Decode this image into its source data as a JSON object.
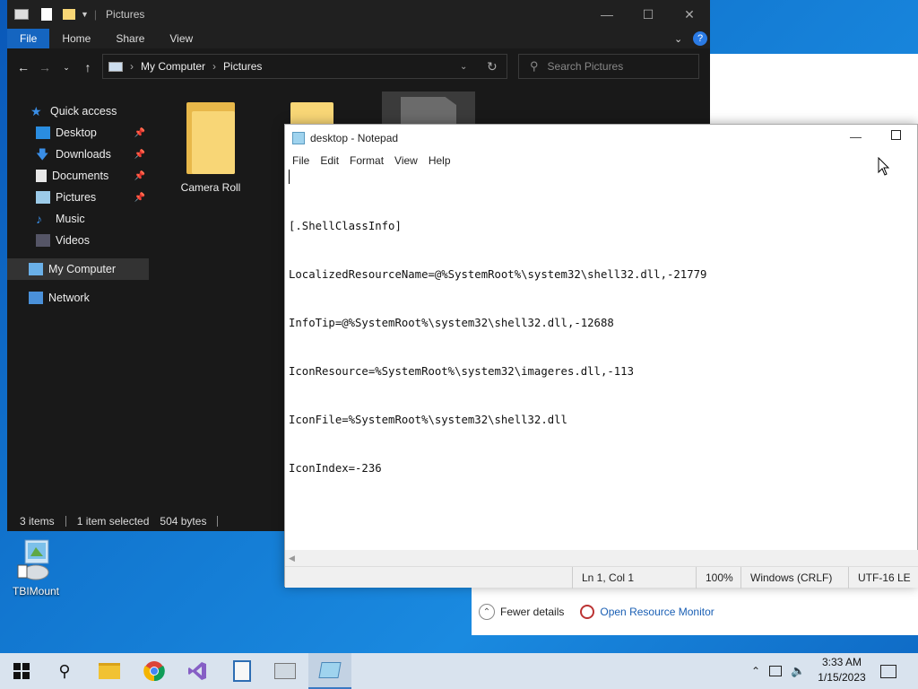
{
  "explorer": {
    "title": "Pictures",
    "ribbon_tabs": [
      "File",
      "Home",
      "Share",
      "View"
    ],
    "breadcrumb": [
      "My Computer",
      "Pictures"
    ],
    "search_placeholder": "Search Pictures",
    "sidebar": [
      {
        "label": "Quick access",
        "icon": "star-icon",
        "pinned": false
      },
      {
        "label": "Desktop",
        "icon": "desktop-icon",
        "pinned": true
      },
      {
        "label": "Downloads",
        "icon": "download-icon",
        "pinned": true
      },
      {
        "label": "Documents",
        "icon": "document-icon",
        "pinned": true
      },
      {
        "label": "Pictures",
        "icon": "pictures-icon",
        "pinned": true
      },
      {
        "label": "Music",
        "icon": "music-icon",
        "pinned": false
      },
      {
        "label": "Videos",
        "icon": "video-icon",
        "pinned": false
      },
      {
        "label": "My Computer",
        "icon": "computer-icon",
        "pinned": false
      },
      {
        "label": "Network",
        "icon": "network-icon",
        "pinned": false
      }
    ],
    "items": [
      {
        "label": "Camera Roll"
      }
    ],
    "status": {
      "count": "3 items",
      "selection": "1 item selected",
      "size": "504 bytes"
    }
  },
  "notepad": {
    "title": "desktop - Notepad",
    "menu": [
      "File",
      "Edit",
      "Format",
      "View",
      "Help"
    ],
    "lines": [
      "[.ShellClassInfo]",
      "LocalizedResourceName=@%SystemRoot%\\system32\\shell32.dll,-21779",
      "InfoTip=@%SystemRoot%\\system32\\shell32.dll,-12688",
      "IconResource=%SystemRoot%\\system32\\imageres.dll,-113",
      "IconFile=%SystemRoot%\\system32\\shell32.dll",
      "IconIndex=-236"
    ],
    "status": {
      "position": "Ln 1, Col 1",
      "zoom": "100%",
      "line_ending": "Windows (CRLF)",
      "encoding": "UTF-16 LE"
    }
  },
  "taskmgr": {
    "fewer_details": "Fewer details",
    "resource_monitor": "Open Resource Monitor"
  },
  "desktop_icon": {
    "label": "TBIMount"
  },
  "clock": {
    "time": "3:33 AM",
    "date": "1/15/2023"
  },
  "colors": {
    "accent": "#1565c0",
    "explorer_bg": "#191919",
    "desktop": "#1277d0"
  }
}
